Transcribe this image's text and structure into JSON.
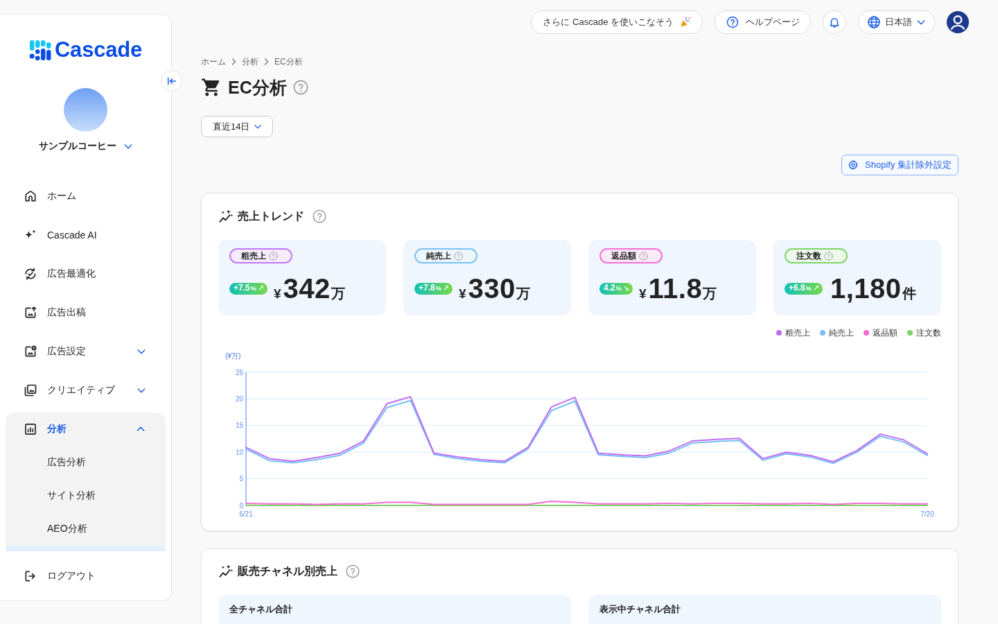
{
  "sidebar": {
    "logo": "Cascade",
    "account": {
      "name": "サンプルコーヒー"
    },
    "nav": [
      {
        "kind": "link",
        "label": "ホーム",
        "selected": false
      },
      {
        "kind": "link",
        "label": "Cascade AI",
        "selected": false
      },
      {
        "kind": "link",
        "label": "広告最適化",
        "selected": false
      },
      {
        "kind": "link",
        "label": "広告出稿",
        "selected": false
      },
      {
        "kind": "group",
        "label": "広告設定",
        "selected": false,
        "expanded": false
      },
      {
        "kind": "group",
        "label": "クリエイティブ",
        "selected": false,
        "expanded": false
      },
      {
        "kind": "group",
        "label": "分析",
        "selected": true,
        "expanded": true,
        "children": [
          {
            "label": "広告分析",
            "selected": false
          },
          {
            "label": "サイト分析",
            "selected": false
          },
          {
            "label": "AEO分析",
            "selected": false
          }
        ]
      }
    ],
    "logout": "ログアウト"
  },
  "top_bar": {
    "promo_button": "さらに Cascade を使いこなそう",
    "help_button": "ヘルプページ",
    "language_select": "日本語"
  },
  "breadcrumb": [
    "ホーム",
    "分析",
    "EC分析"
  ],
  "page_title": "EC分析",
  "period_select": "直近14日",
  "exclusion_settings_button": "Shopify 集計除外設定",
  "sales_trend": {
    "title": "売上トレンド",
    "kpis": [
      {
        "label": "粗売上",
        "color": "#c27af5",
        "change": "+7.5",
        "change_unit": "%",
        "trend_arrow": "↗",
        "currency": "¥",
        "value": "342",
        "unit": "万"
      },
      {
        "label": "純売上",
        "color": "#7cc1f3",
        "change": "+7.8",
        "change_unit": "%",
        "trend_arrow": "↗",
        "currency": "¥",
        "value": "330",
        "unit": "万"
      },
      {
        "label": "返品額",
        "color": "#f46fd6",
        "change": "4.2",
        "change_unit": "%",
        "trend_arrow": "↘",
        "currency": "¥",
        "value": "11.8",
        "unit": "万"
      },
      {
        "label": "注文数",
        "color": "#80d46a",
        "change": "+6.8",
        "change_unit": "%",
        "trend_arrow": "↗",
        "value": "1,180",
        "unit": "件"
      }
    ],
    "chart_data": {
      "type": "line",
      "ylabel": "(¥万)",
      "categories": [
        "6/21",
        null,
        null,
        null,
        null,
        null,
        null,
        null,
        null,
        null,
        null,
        null,
        null,
        null,
        null,
        null,
        null,
        null,
        null,
        null,
        null,
        null,
        null,
        null,
        null,
        null,
        null,
        null,
        null,
        "7/20"
      ],
      "ylim": [
        0,
        25
      ],
      "yticks": [
        0,
        5,
        10,
        15,
        20,
        25
      ],
      "grid": true,
      "legend": true,
      "series": [
        {
          "name": "粗売上",
          "color": "#bf6cf4",
          "values": [
            10.9,
            8.8,
            8.3,
            9.0,
            9.8,
            12.1,
            19.1,
            20.4,
            9.8,
            9.1,
            8.6,
            8.3,
            10.9,
            18.5,
            20.3,
            9.8,
            9.5,
            9.3,
            10.2,
            12.1,
            12.4,
            12.6,
            8.8,
            10.0,
            9.4,
            8.2,
            10.3,
            13.4,
            12.3,
            9.7
          ]
        },
        {
          "name": "純売上",
          "color": "#79bff2",
          "values": [
            10.6,
            8.4,
            8.0,
            8.6,
            9.4,
            11.7,
            18.4,
            19.7,
            9.6,
            8.8,
            8.3,
            8.0,
            10.6,
            17.8,
            19.6,
            9.5,
            9.2,
            9.0,
            9.8,
            11.7,
            12.0,
            12.2,
            8.5,
            9.7,
            9.1,
            7.9,
            10.0,
            13.0,
            11.9,
            9.4
          ]
        },
        {
          "name": "返品額",
          "color": "#f46ad6",
          "values": [
            0.4,
            0.3,
            0.3,
            0.2,
            0.3,
            0.3,
            0.6,
            0.6,
            0.2,
            0.2,
            0.2,
            0.2,
            0.2,
            0.8,
            0.6,
            0.3,
            0.3,
            0.3,
            0.4,
            0.3,
            0.4,
            0.4,
            0.3,
            0.3,
            0.4,
            0.2,
            0.4,
            0.4,
            0.3,
            0.3
          ]
        },
        {
          "name": "注文数",
          "color": "#7bd565",
          "values": [
            0,
            0,
            0,
            0,
            0,
            0,
            0,
            0,
            0,
            0,
            0,
            0,
            0,
            0,
            0,
            0,
            0,
            0,
            0,
            0,
            0,
            0,
            0,
            0,
            0,
            0,
            0,
            0,
            0,
            0
          ]
        }
      ]
    }
  },
  "channel_sales": {
    "title": "販売チャネル別売上",
    "panels": [
      {
        "title": "全チャネル合計"
      },
      {
        "title": "表示中チャネル合計"
      }
    ]
  }
}
